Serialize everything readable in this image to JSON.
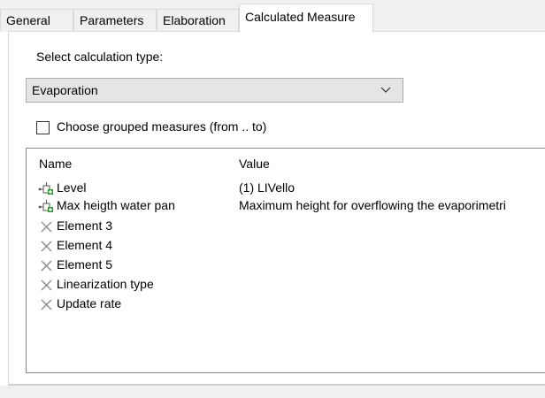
{
  "tabs": [
    {
      "label": "General"
    },
    {
      "label": "Parameters"
    },
    {
      "label": "Elaboration"
    },
    {
      "label": "Calculated Measure",
      "active": true
    }
  ],
  "calc_type": {
    "label": "Select calculation type:",
    "selected": "Evaporation"
  },
  "grouped": {
    "label": "Choose grouped measures (from .. to)",
    "checked": false
  },
  "list": {
    "columns": [
      "Name",
      "Value"
    ],
    "rows": [
      {
        "name": "Level",
        "value": "(1) LIVello",
        "icon": "measure-link-icon"
      },
      {
        "name": "Max heigth water pan",
        "value": "Maximum height for overflowing the evaporimetri",
        "icon": "measure-link-icon"
      },
      {
        "name": "Element 3",
        "value": "",
        "icon": "cross-icon"
      },
      {
        "name": "Element 4",
        "value": "",
        "icon": "cross-icon"
      },
      {
        "name": "Element 5",
        "value": "",
        "icon": "cross-icon"
      },
      {
        "name": "Linearization type",
        "value": "",
        "icon": "cross-icon"
      },
      {
        "name": "Update rate",
        "value": "",
        "icon": "cross-icon"
      }
    ]
  }
}
